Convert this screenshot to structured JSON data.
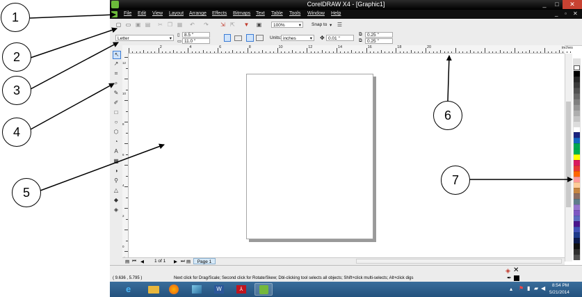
{
  "window": {
    "title": "CorelDRAW X4 - [Graphic1]",
    "controls": [
      "_",
      "□",
      "✕"
    ],
    "doc_controls": [
      "_",
      "▫",
      "✕"
    ]
  },
  "menubar": {
    "items": [
      "File",
      "Edit",
      "View",
      "Layout",
      "Arrange",
      "Effects",
      "Bitmaps",
      "Text",
      "Table",
      "Tools",
      "Window",
      "Help"
    ]
  },
  "standard_toolbar": {
    "zoom_value": "100%",
    "snap_to_label": "Snap to"
  },
  "property_bar": {
    "page_size": "Letter",
    "width_value": "8.5 \"",
    "height_value": "11.0 \"",
    "units_label": "Units:",
    "units_value": "inches",
    "nudge_value": "0.01 \"",
    "dup_x_value": "0.25 \"",
    "dup_y_value": "0.25 \""
  },
  "ruler": {
    "labels": [
      "2",
      "4",
      "6",
      "8",
      "10",
      "12",
      "14",
      "16",
      "18",
      "20"
    ],
    "unit_label": "inches",
    "vertical_labels": [
      "12",
      "10",
      "8",
      "6",
      "4",
      "2",
      "0"
    ],
    "vertical_unit_label": "inches"
  },
  "page_navigator": {
    "page_count_text": "1 of 1",
    "tab_label": "Page 1"
  },
  "statusbar": {
    "coords": "( 9.636 , 5.795 )",
    "hint": "Next click for Drag/Scale; Second click for Rotate/Skew; Dbl-clicking tool selects all objects; Shift+click multi-selects; Alt+click digs"
  },
  "taskbar": {
    "time": "8:54 PM",
    "date": "5/21/2014"
  },
  "palette": {
    "colors": [
      "#ffffff",
      "#000000",
      "#262626",
      "#3b3b3b",
      "#525252",
      "#696969",
      "#808080",
      "#979797",
      "#aeaeae",
      "#c5c5c5",
      "#dcdcdc",
      "#ffffff",
      "#1a237e",
      "#1565c0",
      "#00a64f",
      "#00b050",
      "#ffff00",
      "#d81b60",
      "#e53935",
      "#ff6600",
      "#ff9999",
      "#ffcc99",
      "#c68642",
      "#8d6e63",
      "#607d8b",
      "#9575cd",
      "#7e57c2",
      "#5c6bc0",
      "#4a148c",
      "#3f51b5",
      "#1e3a8a",
      "#0d1b4c",
      "#111111",
      "#2f2f2f",
      "#505050"
    ]
  },
  "callouts": {
    "c1": "1",
    "c2": "2",
    "c3": "3",
    "c4": "4",
    "c5": "5",
    "c6": "6",
    "c7": "7"
  }
}
